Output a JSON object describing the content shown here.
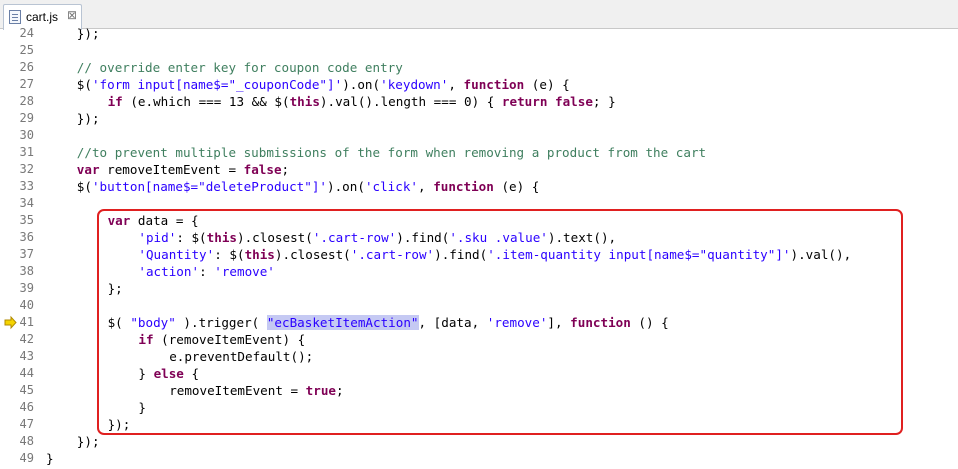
{
  "tab": {
    "file_name": "cart.js",
    "close_symbol": "⊠"
  },
  "highlight": {
    "color": "#e02020",
    "from_line": "35",
    "to_line": "47"
  },
  "lines": [
    {
      "num": "24",
      "indent": 4,
      "tokens": [
        [
          "p",
          "});"
        ]
      ]
    },
    {
      "num": "25",
      "indent": 0,
      "tokens": []
    },
    {
      "num": "26",
      "indent": 4,
      "tokens": [
        [
          "c",
          "// override enter key for coupon code entry"
        ]
      ]
    },
    {
      "num": "27",
      "indent": 4,
      "tokens": [
        [
          "p",
          "$("
        ],
        [
          "s",
          "'form input[name$=\"_couponCode\"]'"
        ],
        [
          "p",
          ").on("
        ],
        [
          "s",
          "'keydown'"
        ],
        [
          "p",
          ", "
        ],
        [
          "k",
          "function"
        ],
        [
          "p",
          " (e) {"
        ]
      ]
    },
    {
      "num": "28",
      "indent": 8,
      "tokens": [
        [
          "k",
          "if"
        ],
        [
          "p",
          " (e.which === 13 && $("
        ],
        [
          "k",
          "this"
        ],
        [
          "p",
          ").val().length === 0) { "
        ],
        [
          "k",
          "return"
        ],
        [
          "p",
          " "
        ],
        [
          "k",
          "false"
        ],
        [
          "p",
          "; }"
        ]
      ]
    },
    {
      "num": "29",
      "indent": 4,
      "tokens": [
        [
          "p",
          "});"
        ]
      ]
    },
    {
      "num": "30",
      "indent": 0,
      "tokens": []
    },
    {
      "num": "31",
      "indent": 4,
      "tokens": [
        [
          "c",
          "//to prevent multiple submissions of the form when removing a product from the cart"
        ]
      ]
    },
    {
      "num": "32",
      "indent": 4,
      "tokens": [
        [
          "k",
          "var"
        ],
        [
          "p",
          " removeItemEvent = "
        ],
        [
          "k",
          "false"
        ],
        [
          "p",
          ";"
        ]
      ]
    },
    {
      "num": "33",
      "indent": 4,
      "tokens": [
        [
          "p",
          "$("
        ],
        [
          "s",
          "'button[name$=\"deleteProduct\"]'"
        ],
        [
          "p",
          ").on("
        ],
        [
          "s",
          "'click'"
        ],
        [
          "p",
          ", "
        ],
        [
          "k",
          "function"
        ],
        [
          "p",
          " (e) {"
        ]
      ]
    },
    {
      "num": "34",
      "indent": 0,
      "tokens": []
    },
    {
      "num": "35",
      "indent": 8,
      "tokens": [
        [
          "k",
          "var"
        ],
        [
          "p",
          " data = {"
        ]
      ]
    },
    {
      "num": "36",
      "indent": 12,
      "tokens": [
        [
          "s",
          "'pid'"
        ],
        [
          "p",
          ": $("
        ],
        [
          "k",
          "this"
        ],
        [
          "p",
          ").closest("
        ],
        [
          "s",
          "'.cart-row'"
        ],
        [
          "p",
          ").find("
        ],
        [
          "s",
          "'.sku .value'"
        ],
        [
          "p",
          ").text(),"
        ]
      ]
    },
    {
      "num": "37",
      "indent": 12,
      "tokens": [
        [
          "s",
          "'Quantity'"
        ],
        [
          "p",
          ": $("
        ],
        [
          "k",
          "this"
        ],
        [
          "p",
          ").closest("
        ],
        [
          "s",
          "'.cart-row'"
        ],
        [
          "p",
          ").find("
        ],
        [
          "s",
          "'.item-quantity input[name$=\"quantity\"]'"
        ],
        [
          "p",
          ").val(),"
        ]
      ]
    },
    {
      "num": "38",
      "indent": 12,
      "tokens": [
        [
          "s",
          "'action'"
        ],
        [
          "p",
          ": "
        ],
        [
          "s",
          "'remove'"
        ]
      ]
    },
    {
      "num": "39",
      "indent": 8,
      "tokens": [
        [
          "p",
          "};"
        ]
      ]
    },
    {
      "num": "40",
      "indent": 0,
      "tokens": []
    },
    {
      "num": "41",
      "indent": 8,
      "marker": true,
      "tokens": [
        [
          "p",
          "$( "
        ],
        [
          "s",
          "\"body\""
        ],
        [
          "p",
          " ).trigger( "
        ],
        [
          "h",
          "\"ecBasketItemAction\""
        ],
        [
          "p",
          ", [data, "
        ],
        [
          "s",
          "'remove'"
        ],
        [
          "p",
          "], "
        ],
        [
          "k",
          "function"
        ],
        [
          "p",
          " () {"
        ]
      ]
    },
    {
      "num": "42",
      "indent": 12,
      "tokens": [
        [
          "k",
          "if"
        ],
        [
          "p",
          " (removeItemEvent) {"
        ]
      ]
    },
    {
      "num": "43",
      "indent": 16,
      "tokens": [
        [
          "p",
          "e.preventDefault();"
        ]
      ]
    },
    {
      "num": "44",
      "indent": 12,
      "tokens": [
        [
          "p",
          "} "
        ],
        [
          "k",
          "else"
        ],
        [
          "p",
          " {"
        ]
      ]
    },
    {
      "num": "45",
      "indent": 16,
      "tokens": [
        [
          "p",
          "removeItemEvent = "
        ],
        [
          "k",
          "true"
        ],
        [
          "p",
          ";"
        ]
      ]
    },
    {
      "num": "46",
      "indent": 12,
      "tokens": [
        [
          "p",
          "}"
        ]
      ]
    },
    {
      "num": "47",
      "indent": 8,
      "tokens": [
        [
          "p",
          "});"
        ]
      ]
    },
    {
      "num": "48",
      "indent": 4,
      "tokens": [
        [
          "p",
          "});"
        ]
      ]
    },
    {
      "num": "49",
      "indent": 0,
      "tokens": [
        [
          "p",
          "}"
        ]
      ]
    }
  ]
}
